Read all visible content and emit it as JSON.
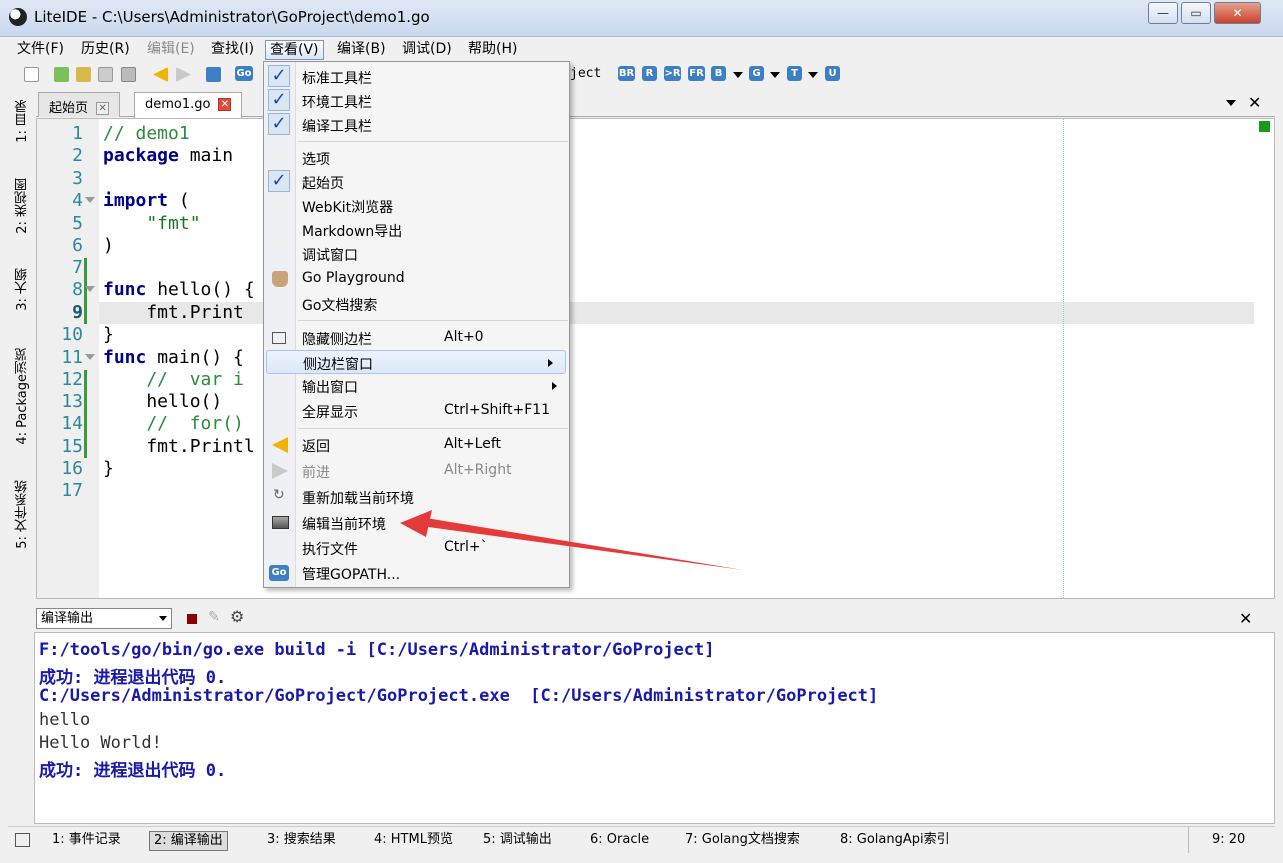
{
  "window": {
    "title": "LiteIDE - C:\\Users\\Administrator\\GoProject\\demo1.go"
  },
  "menubar": {
    "items": [
      "文件(F)",
      "历史(R)",
      "编辑(E)",
      "查找(I)",
      "查看(V)",
      "编译(B)",
      "调试(D)",
      "帮助(H)"
    ]
  },
  "toolbar": {
    "env_fragment": "ject",
    "buttons": [
      "BR",
      "R",
      ">R",
      "FR",
      "B",
      "G",
      "T",
      "U"
    ]
  },
  "sidebar": {
    "tabs": [
      "1: 目录",
      "2: 类视图",
      "3: 大纲",
      "4: Package浏览",
      "5: 文件系统"
    ]
  },
  "tabs": [
    {
      "label": "起始页"
    },
    {
      "label": "demo1.go"
    }
  ],
  "editor": {
    "line_numbers": [
      "1",
      "2",
      "3",
      "4",
      "5",
      "6",
      "7",
      "8",
      "9",
      "10",
      "11",
      "12",
      "13",
      "14",
      "15",
      "16",
      "17"
    ],
    "current_line": "9",
    "lines": {
      "l1": "// demo1",
      "l2_kw": "package",
      "l2": " main",
      "l4_kw": "import",
      "l4": " (",
      "l5": "    \"fmt\"",
      "l6": ")",
      "l8_kw": "func",
      "l8": " hello() {",
      "l9": "    fmt.Print",
      "l10": "}",
      "l11_kw": "func",
      "l11": " main() {",
      "l12": "    //  var i",
      "l13": "    hello()",
      "l14": "    //  for()",
      "l15": "    fmt.Printl",
      "l16": "}"
    }
  },
  "view_menu": {
    "items": [
      {
        "label": "标准工具栏",
        "checked": true
      },
      {
        "label": "环境工具栏",
        "checked": true
      },
      {
        "label": "编译工具栏",
        "checked": true
      },
      {
        "label": "选项"
      },
      {
        "label": "起始页",
        "checked": true
      },
      {
        "label": "WebKit浏览器"
      },
      {
        "label": "Markdown导出"
      },
      {
        "label": "调试窗口"
      },
      {
        "label": "Go Playground",
        "icon": "playground-icon"
      },
      {
        "label": "Go文档搜索"
      },
      {
        "label": "隐藏侧边栏",
        "shortcut": "Alt+0",
        "icon": "sidebar-icon"
      },
      {
        "label": "侧边栏窗口",
        "submenu": true,
        "highlighted": true
      },
      {
        "label": "输出窗口",
        "submenu": true
      },
      {
        "label": "全屏显示",
        "shortcut": "Ctrl+Shift+F11"
      },
      {
        "label": "返回",
        "shortcut": "Alt+Left",
        "icon": "back-icon"
      },
      {
        "label": "前进",
        "shortcut": "Alt+Right",
        "disabled": true,
        "icon": "forward-icon"
      },
      {
        "label": "重新加载当前环境",
        "icon": "reload-icon"
      },
      {
        "label": "编辑当前环境",
        "icon": "edit-env-icon"
      },
      {
        "label": "执行文件",
        "shortcut": "Ctrl+`"
      },
      {
        "label": "管理GOPATH...",
        "icon": "gopath-icon"
      }
    ]
  },
  "output_panel": {
    "selector": "编译输出",
    "lines": [
      "F:/tools/go/bin/go.exe build -i [C:/Users/Administrator/GoProject]",
      "成功: 进程退出代码 0.",
      "C:/Users/Administrator/GoProject/GoProject.exe  [C:/Users/Administrator/GoProject]",
      "hello",
      "Hello World!",
      "成功: 进程退出代码 0."
    ]
  },
  "statusbar": {
    "tabs": [
      "1: 事件记录",
      "2: 编译输出",
      "3: 搜索结果",
      "4: HTML预览",
      "5: 调试输出",
      "6: Oracle",
      "7: Golang文档搜索",
      "8: GolangApi索引"
    ],
    "position": "9: 20"
  },
  "colors": {
    "accent": "#3d7fc4",
    "annotation_arrow": "#e53a3a",
    "keyword": "#00008b",
    "comment": "#2e8b3a",
    "output_blue": "#1a1aaa"
  }
}
